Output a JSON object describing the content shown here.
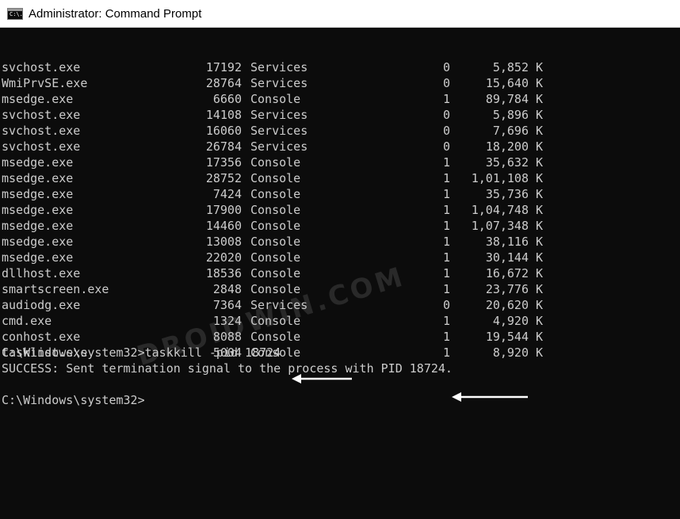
{
  "window": {
    "title": "Administrator: Command Prompt",
    "icon": "cmd-icon",
    "icon_glyph": "C:\\."
  },
  "processes": [
    {
      "name": "svchost.exe",
      "pid": "17192",
      "session": "Services",
      "num": "0",
      "mem": "5,852",
      "unit": "K"
    },
    {
      "name": "WmiPrvSE.exe",
      "pid": "28764",
      "session": "Services",
      "num": "0",
      "mem": "15,640",
      "unit": "K"
    },
    {
      "name": "msedge.exe",
      "pid": "6660",
      "session": "Console",
      "num": "1",
      "mem": "89,784",
      "unit": "K"
    },
    {
      "name": "svchost.exe",
      "pid": "14108",
      "session": "Services",
      "num": "0",
      "mem": "5,896",
      "unit": "K"
    },
    {
      "name": "svchost.exe",
      "pid": "16060",
      "session": "Services",
      "num": "0",
      "mem": "7,696",
      "unit": "K"
    },
    {
      "name": "svchost.exe",
      "pid": "26784",
      "session": "Services",
      "num": "0",
      "mem": "18,200",
      "unit": "K"
    },
    {
      "name": "msedge.exe",
      "pid": "17356",
      "session": "Console",
      "num": "1",
      "mem": "35,632",
      "unit": "K"
    },
    {
      "name": "msedge.exe",
      "pid": "28752",
      "session": "Console",
      "num": "1",
      "mem": "1,01,108",
      "unit": "K"
    },
    {
      "name": "msedge.exe",
      "pid": "7424",
      "session": "Console",
      "num": "1",
      "mem": "35,736",
      "unit": "K"
    },
    {
      "name": "msedge.exe",
      "pid": "17900",
      "session": "Console",
      "num": "1",
      "mem": "1,04,748",
      "unit": "K"
    },
    {
      "name": "msedge.exe",
      "pid": "14460",
      "session": "Console",
      "num": "1",
      "mem": "1,07,348",
      "unit": "K"
    },
    {
      "name": "msedge.exe",
      "pid": "13008",
      "session": "Console",
      "num": "1",
      "mem": "38,116",
      "unit": "K"
    },
    {
      "name": "msedge.exe",
      "pid": "22020",
      "session": "Console",
      "num": "1",
      "mem": "30,144",
      "unit": "K"
    },
    {
      "name": "dllhost.exe",
      "pid": "18536",
      "session": "Console",
      "num": "1",
      "mem": "16,672",
      "unit": "K"
    },
    {
      "name": "smartscreen.exe",
      "pid": "2848",
      "session": "Console",
      "num": "1",
      "mem": "23,776",
      "unit": "K"
    },
    {
      "name": "audiodg.exe",
      "pid": "7364",
      "session": "Services",
      "num": "0",
      "mem": "20,620",
      "unit": "K"
    },
    {
      "name": "cmd.exe",
      "pid": "1324",
      "session": "Console",
      "num": "1",
      "mem": "4,920",
      "unit": "K"
    },
    {
      "name": "conhost.exe",
      "pid": "8088",
      "session": "Console",
      "num": "1",
      "mem": "19,544",
      "unit": "K"
    },
    {
      "name": "tasklist.exe",
      "pid": "5004",
      "session": "Console",
      "num": "1",
      "mem": "8,920",
      "unit": "K"
    }
  ],
  "command": {
    "prompt": "C:\\Windows\\system32>",
    "text": "taskkill -pid 18724"
  },
  "output": "SUCCESS: Sent termination signal to the process with PID 18724.",
  "final_prompt": "C:\\Windows\\system32>",
  "watermark": "DROIDWIN.COM",
  "colors": {
    "background": "#0c0c0c",
    "text": "#cccccc",
    "titlebar": "#ffffff",
    "arrow": "#ffffff"
  }
}
